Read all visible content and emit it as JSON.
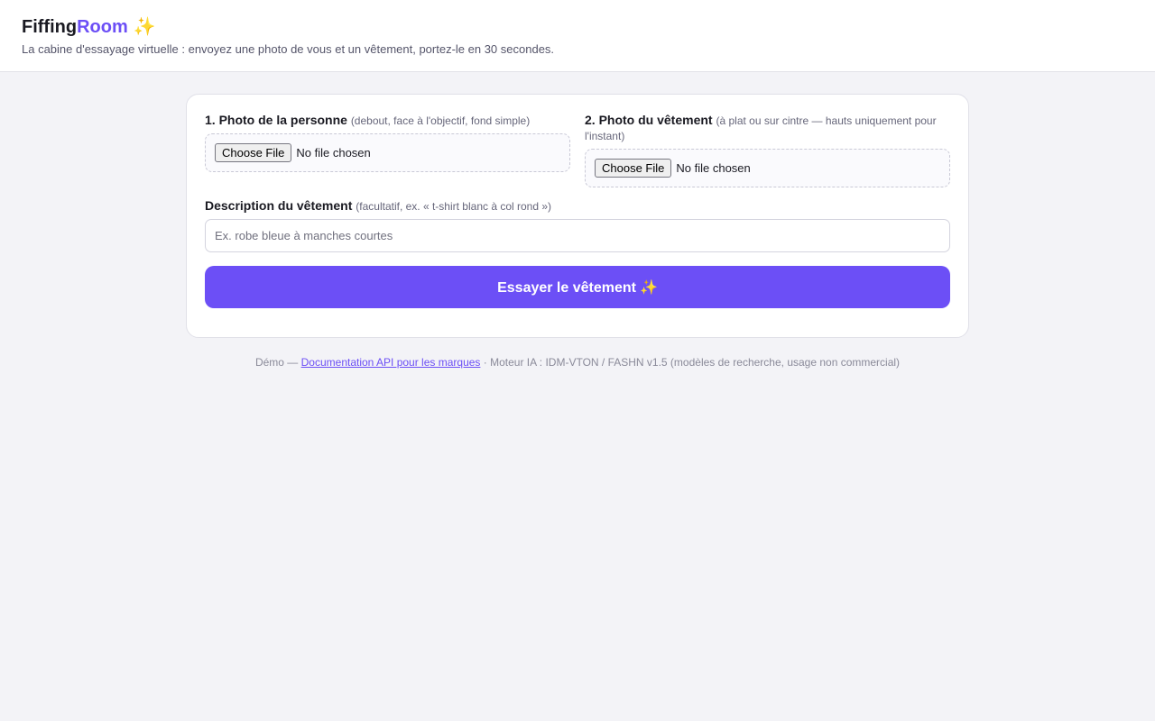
{
  "header": {
    "brand_part1": "Fiffing",
    "brand_part2": "Room",
    "brand_emoji": "✨",
    "tagline": "La cabine d'essayage virtuelle : envoyez une photo de vous et un vêtement, portez-le en 30 secondes."
  },
  "form": {
    "person_photo": {
      "label": "1. Photo de la personne",
      "hint": "(debout, face à l'objectif, fond simple)",
      "button": "Choose File",
      "status": "No file chosen"
    },
    "garment_photo": {
      "label": "2. Photo du vêtement",
      "hint": "(à plat ou sur cintre — hauts uniquement pour l'instant)",
      "button": "Choose File",
      "status": "No file chosen"
    },
    "description": {
      "label": "Description du vêtement",
      "hint": "(facultatif, ex. « t-shirt blanc à col rond »)",
      "placeholder": "Ex. robe bleue à manches courtes",
      "value": ""
    },
    "submit_label": "Essayer le vêtement",
    "submit_emoji": "✨"
  },
  "footer": {
    "prefix": "Démo —",
    "link_text": "Documentation API pour les marques",
    "suffix": "· Moteur IA : IDM-VTON / FASHN v1.5 (modèles de recherche, usage non commercial)"
  },
  "colors": {
    "accent": "#6c4ff6",
    "background": "#f3f3f7",
    "sparkle": "#f1b51a"
  }
}
